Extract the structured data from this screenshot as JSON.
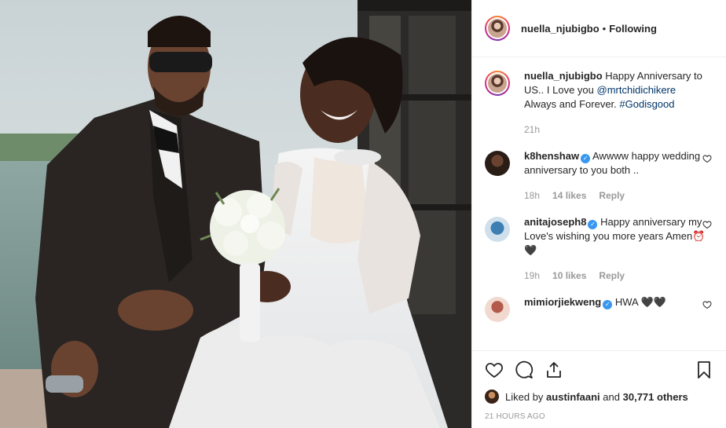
{
  "post": {
    "author": "nuella_njubigbo",
    "separator": "•",
    "follow_state": "Following",
    "image_alt": "Couple in wedding attire"
  },
  "caption": {
    "user": "nuella_njubigbo",
    "text_before": "Happy Anniversary to US.. I Love you ",
    "mention": "@mrtchidichikere",
    "text_after": " Always and Forever. ",
    "hashtag": "#Godisgood",
    "time": "21h"
  },
  "comments": [
    {
      "user": "k8henshaw",
      "verified": true,
      "text": "Awwww happy wedding anniversary to you both ..",
      "time": "18h",
      "likes": "14 likes",
      "reply": "Reply"
    },
    {
      "user": "anitajoseph8",
      "verified": true,
      "text": "Happy anniversary my Love's wishing you more years Amen⏰🖤",
      "time": "19h",
      "likes": "10 likes",
      "reply": "Reply"
    },
    {
      "user": "mimiorjiekweng",
      "verified": true,
      "text": "HWA 🖤🖤"
    }
  ],
  "footer": {
    "liked_by_prefix": "Liked by ",
    "liked_by_user": "austinfaani",
    "liked_by_and": " and ",
    "liked_by_others": "30,771 others",
    "timestamp": "21 HOURS AGO"
  },
  "colors": {
    "accent_link": "#003569",
    "verified": "#3897f0",
    "muted": "#999999"
  }
}
